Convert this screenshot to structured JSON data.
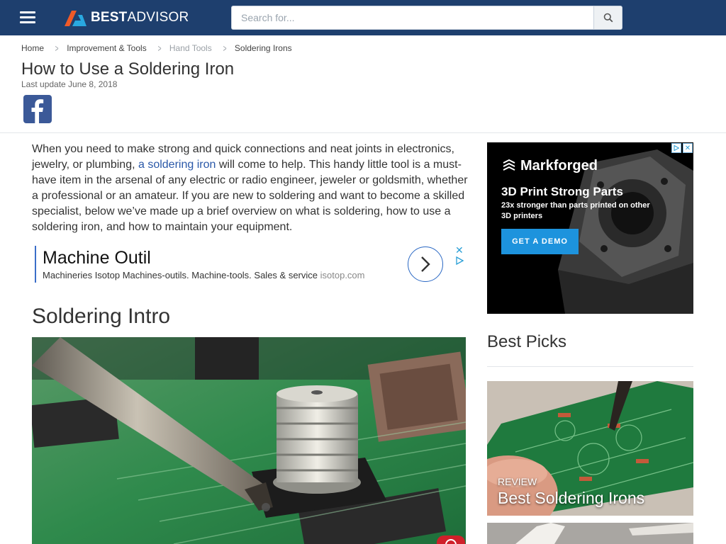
{
  "header": {
    "brand_bold": "BEST",
    "brand_rest": "ADVISOR",
    "search_placeholder": "Search for...",
    "colors": {
      "bar": "#1e3f6e",
      "logo_orange": "#f05a28",
      "logo_blue": "#29a8e0"
    }
  },
  "breadcrumb": [
    "Home",
    "Improvement & Tools",
    "Hand Tools",
    "Soldering Irons"
  ],
  "article": {
    "title": "How to Use a Soldering Iron",
    "last_update": "Last update June 8, 2018",
    "intro_before": "When you need to make strong and quick connections and neat joints in electronics, jewelry, or plumbing, ",
    "intro_link": "a soldering iron",
    "intro_after": " will come to help. This handy little tool is a must-have item in the arsenal of any electric or radio engineer, jeweler or goldsmith, whether a professional or an amateur. If you are new to soldering and want to become a skilled specialist, below we’ve made up a brief overview on what is soldering, how to use a soldering iron, and how to maintain your equipment.",
    "section_heading": "Soldering Intro"
  },
  "text_ad": {
    "title": "Machine Outil",
    "description": "Machineries Isotop Machines-outils. Machine-tools. Sales & service ",
    "domain": "isotop.com",
    "close": "✕"
  },
  "sidebar": {
    "display_ad": {
      "brand": "Markforged",
      "headline": "3D Print Strong Parts",
      "subline": "23x stronger than parts printed on other 3D printers",
      "cta": "GET A DEMO",
      "adchoice_close": "✕"
    },
    "best_picks_heading": "Best Picks",
    "picks": [
      {
        "tag": "REVIEW",
        "title": "Best Soldering Irons"
      }
    ]
  }
}
